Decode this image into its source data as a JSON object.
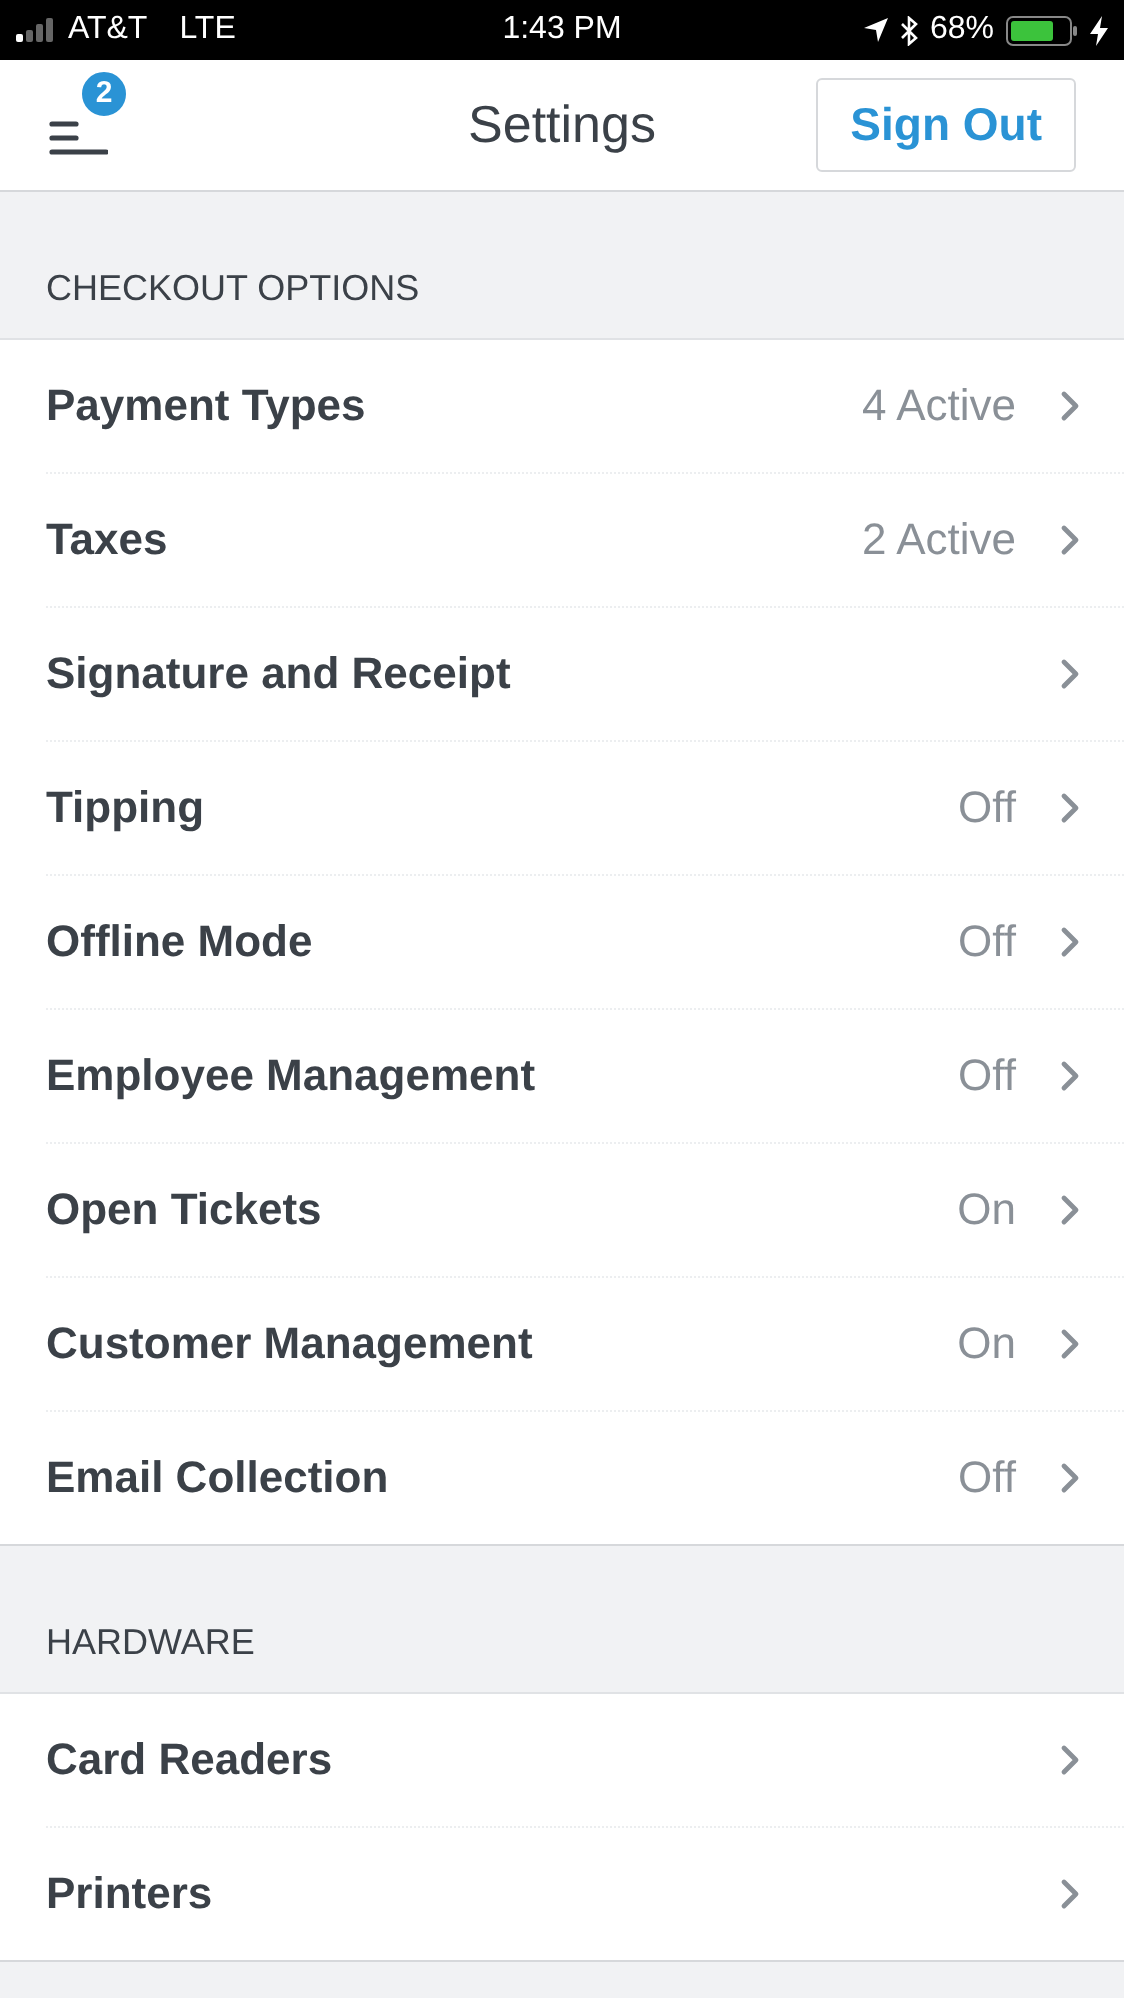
{
  "status_bar": {
    "carrier": "AT&T",
    "network": "LTE",
    "time": "1:43 PM",
    "battery": "68%"
  },
  "header": {
    "badge": "2",
    "title": "Settings",
    "sign_out": "Sign Out"
  },
  "sections": [
    {
      "title": "CHECKOUT OPTIONS",
      "items": [
        {
          "label": "Payment Types",
          "value": "4 Active"
        },
        {
          "label": "Taxes",
          "value": "2 Active"
        },
        {
          "label": "Signature and Receipt"
        },
        {
          "label": "Tipping",
          "value": "Off"
        },
        {
          "label": "Offline Mode",
          "value": "Off"
        },
        {
          "label": "Employee Management",
          "value": "Off"
        },
        {
          "label": "Open Tickets",
          "value": "On"
        },
        {
          "label": "Customer Management",
          "value": "On"
        },
        {
          "label": "Email Collection",
          "value": "Off"
        }
      ]
    },
    {
      "title": "HARDWARE",
      "items": [
        {
          "label": "Card Readers"
        },
        {
          "label": "Printers"
        }
      ]
    }
  ]
}
